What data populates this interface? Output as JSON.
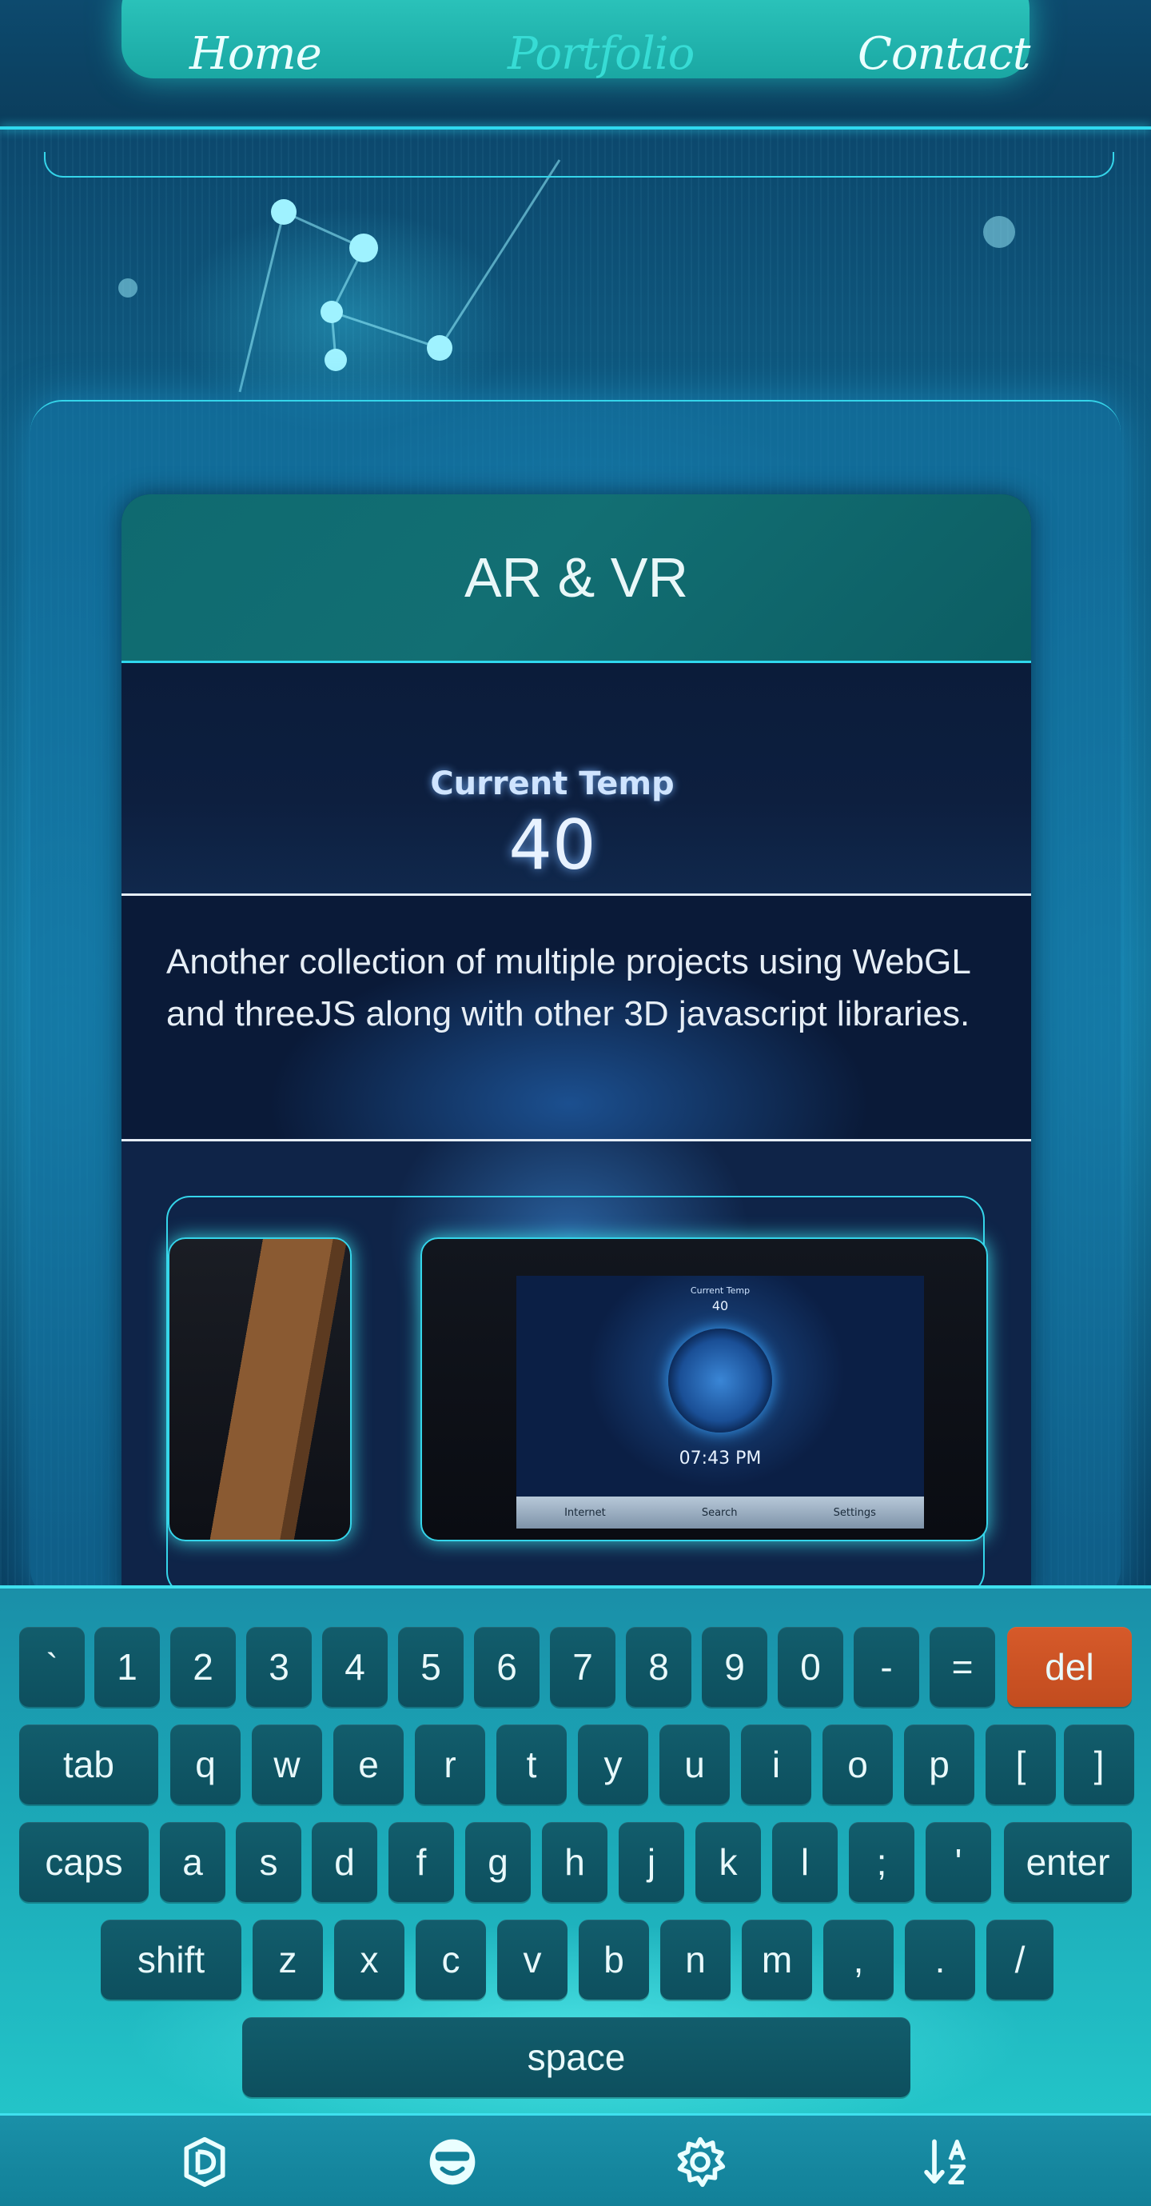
{
  "nav": {
    "home": "Home",
    "portfolio": "Portfolio",
    "contact": "Contact",
    "active": "portfolio"
  },
  "card": {
    "title": "AR & VR",
    "hero": {
      "label": "Current Temp",
      "value": "40"
    },
    "description": "Another collection of multiple projects using WebGL and threeJS along with other 3D javascript libraries.",
    "gallery": {
      "device": {
        "label": "Current Temp",
        "value": "40",
        "time": "07:43 PM",
        "menu": [
          "Internet",
          "Search",
          "Settings"
        ]
      }
    }
  },
  "keyboard": {
    "row1": [
      "`",
      "1",
      "2",
      "3",
      "4",
      "5",
      "6",
      "7",
      "8",
      "9",
      "0",
      "-",
      "=",
      "del"
    ],
    "row2": [
      "tab",
      "q",
      "w",
      "e",
      "r",
      "t",
      "y",
      "u",
      "i",
      "o",
      "p",
      "[",
      "]"
    ],
    "row3": [
      "caps",
      "a",
      "s",
      "d",
      "f",
      "g",
      "h",
      "j",
      "k",
      "l",
      ";",
      "'",
      "enter"
    ],
    "row4": [
      "shift",
      "z",
      "x",
      "c",
      "v",
      "b",
      "n",
      "m",
      ",",
      ".",
      "/"
    ],
    "row5": [
      "space"
    ]
  },
  "bottom_bar": {
    "icons": [
      "font-icon",
      "emoji-icon",
      "settings-gear-icon",
      "sort-az-icon"
    ]
  },
  "colors": {
    "accent": "#2fd8ee",
    "nav_pill": "#1fb3ad",
    "key": "#0f5565",
    "del_key": "#d0552a",
    "card_header": "#0f6a70"
  }
}
